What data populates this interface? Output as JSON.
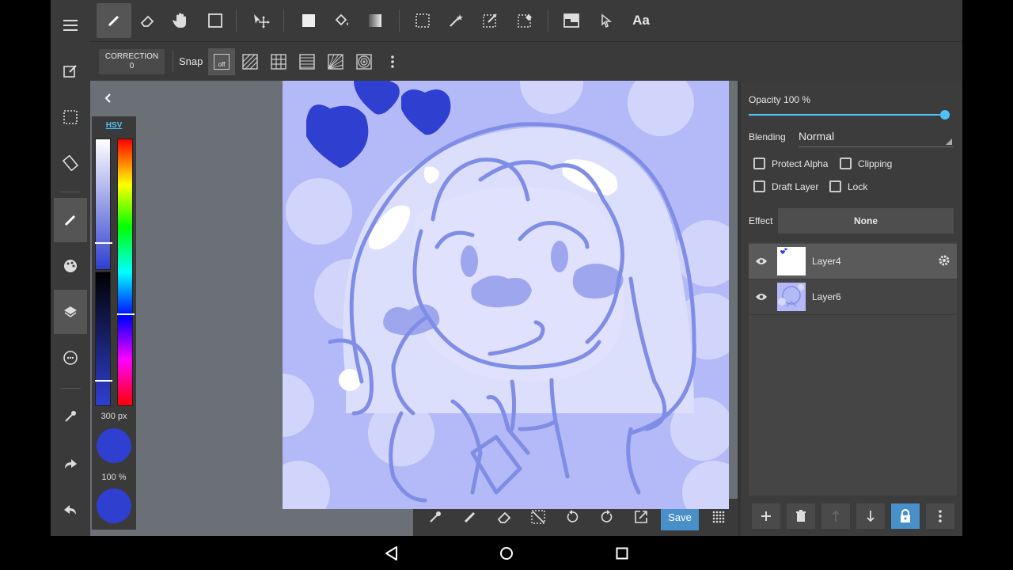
{
  "toolbar": {
    "tools": [
      "pen-tool",
      "eraser-tool",
      "hand-tool",
      "shape-tool",
      "move-tool",
      "fill-rect-tool",
      "bucket-tool",
      "gradient-tool",
      "select-rect-tool",
      "magic-wand-tool",
      "select-pen-tool",
      "select-eraser-tool",
      "canvas-tool",
      "pointer-tool"
    ],
    "text_tool_label": "Aa"
  },
  "subbar": {
    "correction_label": "CORRECTION",
    "correction_value": "0",
    "snap_label": "Snap",
    "snap_off_label": "off"
  },
  "color_panel": {
    "mode_tab": "HSV",
    "brush_size": "300 px",
    "brush_opacity": "100 %",
    "primary_color": "#2f3fd0",
    "secondary_color": "#2f3fd0"
  },
  "bottombar": {
    "save_label": "Save"
  },
  "layer_panel": {
    "opacity_label": "Opacity 100 %",
    "opacity_value": 1.0,
    "blending_label": "Blending",
    "blending_value": "Normal",
    "protect_alpha_label": "Protect Alpha",
    "clipping_label": "Clipping",
    "draft_layer_label": "Draft Layer",
    "lock_label": "Lock",
    "effect_label": "Effect",
    "effect_value": "None",
    "layers": [
      {
        "name": "Layer4",
        "selected": true
      },
      {
        "name": "Layer6",
        "selected": false
      }
    ]
  },
  "colors": {
    "accent": "#4fc3f7",
    "button_blue": "#4a90c8",
    "canvas_bg": "#b4baf7",
    "heart": "#2f3fd0"
  }
}
